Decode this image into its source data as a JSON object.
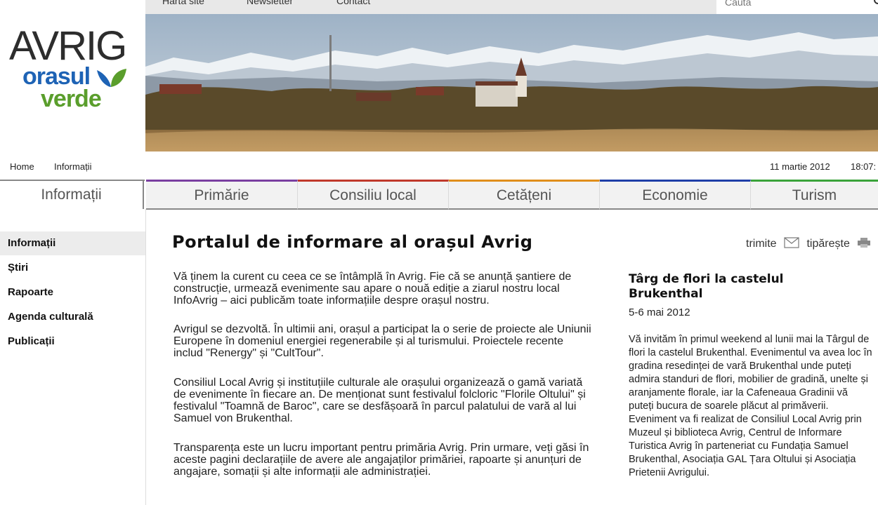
{
  "topbar": {
    "links": [
      "Harta site",
      "Newsletter",
      "Contact"
    ],
    "search_placeholder": "Caută"
  },
  "logo": {
    "line1": "AVRIG",
    "line2": "orasul",
    "line3": "verde"
  },
  "breadcrumb": {
    "home": "Home",
    "current": "Informații"
  },
  "datetime": {
    "date": "11 martie 2012",
    "time": "18:07:"
  },
  "nav": {
    "active": "Informații",
    "tabs": [
      {
        "label": "Primărie",
        "color": "#7a3fa0"
      },
      {
        "label": "Consiliu local",
        "color": "#c0392b"
      },
      {
        "label": "Cetățeni",
        "color": "#e08e1b"
      },
      {
        "label": "Economie",
        "color": "#1f3fa8"
      },
      {
        "label": "Turism",
        "color": "#3aa33a"
      }
    ]
  },
  "sidebar": {
    "items": [
      "Informații",
      "Știri",
      "Rapoarte",
      "Agenda culturală",
      "Publicații"
    ]
  },
  "main": {
    "title": "Portalul de informare al orașul Avrig",
    "actions": {
      "send": "trimite",
      "print": "tipărește"
    },
    "paragraphs": [
      "Vă ținem la curent cu ceea ce se întâmplă în Avrig. Fie că se anunță șantiere de construcție, urmează evenimente sau apare o nouă ediție a ziarul nostru local InfoAvrig – aici publicăm toate informațiile despre orașul nostru.",
      "Avrigul se dezvoltă. În ultimii ani, orașul a participat la o serie de proiecte ale Uniunii Europene în domeniul energiei regenerabile și al turismului. Proiectele recente includ \"Renergy\" și \"CultTour\".",
      "Consiliul Local Avrig și instituțiile culturale ale orașului organizează o gamă variată de evenimente în fiecare an. De menționat sunt festivalul folcloric \"Florile Oltului\" și festivalul \"Toamnă de Baroc\", care se desfășoară în parcul palatului de vară al lui Samuel von Brukenthal.",
      "Transparența este un lucru important pentru primăria Avrig. Prin urmare, veți găsi în aceste pagini declarațiile de avere ale angajaților primăriei, rapoarte și anunțuri de angajare, somații și alte informații ale administrației."
    ]
  },
  "event": {
    "title": "Târg de flori la castelul Brukenthal",
    "date": "5-6 mai 2012",
    "body": "Vă invităm în primul weekend al lunii mai la Târgul de flori la castelul Brukenthal. Evenimentul va avea loc în gradina resedinței de vară Brukenthal unde puteți admira standuri de flori, mobilier de gradină, unelte și aranjamente florale, iar la Cafeneaua Gradinii vă puteți bucura de soarele plăcut al primăverii. Eveniment va fi realizat de Consiliul Local Avrig prin Muzeul și biblioteca Avrig, Centrul de Informare Turistica Avrig în parteneriat cu Fundația Samuel Brukenthal, Asociația GAL Țara Oltului și Asociația Prietenii Avrigului."
  }
}
